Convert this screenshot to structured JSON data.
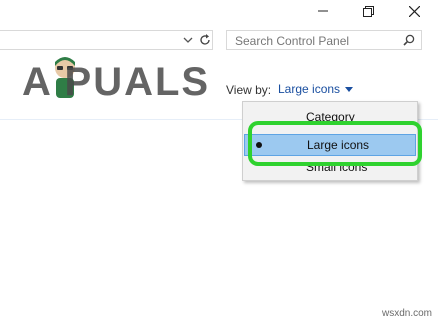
{
  "window_controls": {
    "minimize_icon": "minimize-icon",
    "restore_icon": "restore-icon",
    "close_icon": "close-icon"
  },
  "address_bar": {
    "value": ""
  },
  "search": {
    "placeholder": "Search Control Panel"
  },
  "logo": {
    "text": "A PUALS"
  },
  "view_by": {
    "label": "View by:",
    "value": "Large icons"
  },
  "menu": {
    "items": [
      {
        "label": "Category",
        "selected": false
      },
      {
        "label": "Large icons",
        "selected": true
      },
      {
        "label": "Small icons",
        "selected": false
      }
    ]
  },
  "watermark": "wsxdn.com",
  "colors": {
    "accent": "#1a4fa0",
    "selection": "#9cc9f0",
    "highlight_ring": "#2fd22f"
  }
}
